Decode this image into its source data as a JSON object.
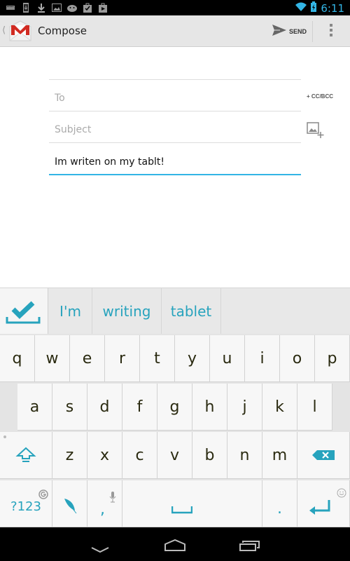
{
  "status_bar": {
    "left_icons": [
      "keyboard-icon",
      "phone-download-icon",
      "download-icon",
      "image-icon",
      "android-icon",
      "play-store-check-icon",
      "play-store-icon"
    ],
    "right_icons": [
      "wifi-icon",
      "battery-charging-icon"
    ],
    "time": "6:11",
    "accent_color": "#33b5e5"
  },
  "action_bar": {
    "title": "Compose",
    "send_label": "SEND",
    "icons": [
      "back-caret-icon",
      "gmail-logo-icon",
      "send-icon",
      "overflow-menu-icon"
    ]
  },
  "compose": {
    "to_placeholder": "To",
    "to_value": "",
    "cc_bcc_label": "+ CC/BCC",
    "subject_placeholder": "Subject",
    "subject_value": "",
    "body_value": "Im writen on my tablt!",
    "attach_icon": "add-image-icon"
  },
  "suggestions": {
    "items": [
      "I'm",
      "writing",
      "tablet"
    ],
    "accent_color": "#27a3bd"
  },
  "keyboard": {
    "row1": [
      "q",
      "w",
      "e",
      "r",
      "t",
      "y",
      "u",
      "i",
      "o",
      "p"
    ],
    "row2": [
      "a",
      "s",
      "d",
      "f",
      "g",
      "h",
      "j",
      "k",
      "l"
    ],
    "row3": [
      "z",
      "x",
      "c",
      "v",
      "b",
      "n",
      "m"
    ],
    "symbols_label": "?123",
    "comma_label": ",",
    "period_label": "."
  },
  "nav_bar": {
    "buttons": [
      "back-icon",
      "home-icon",
      "recent-apps-icon"
    ]
  }
}
